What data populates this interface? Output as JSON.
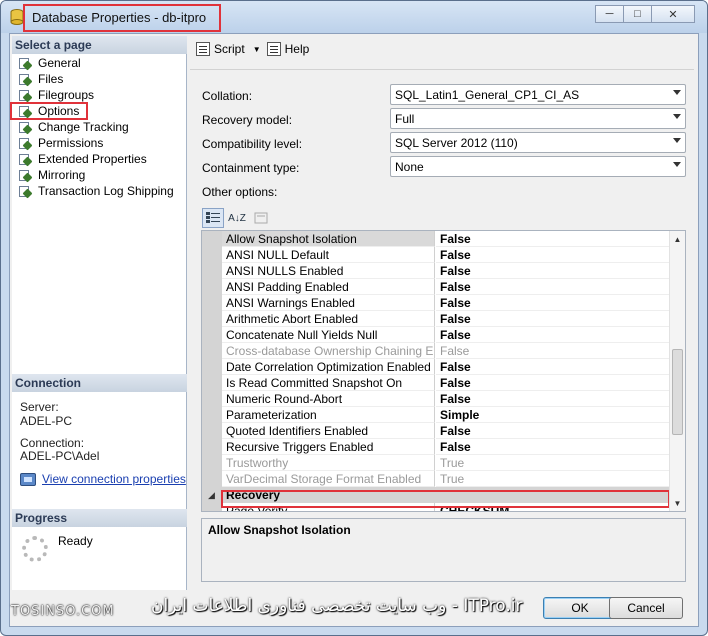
{
  "window": {
    "title": "Database Properties - db-itpro",
    "min_glyph": "─",
    "max_glyph": "□",
    "close_glyph": "✕"
  },
  "left": {
    "select_page_header": "Select a page",
    "pages": [
      {
        "label": "General"
      },
      {
        "label": "Files"
      },
      {
        "label": "Filegroups"
      },
      {
        "label": "Options"
      },
      {
        "label": "Change Tracking"
      },
      {
        "label": "Permissions"
      },
      {
        "label": "Extended Properties"
      },
      {
        "label": "Mirroring"
      },
      {
        "label": "Transaction Log Shipping"
      }
    ],
    "connection_header": "Connection",
    "server_label": "Server:",
    "server_value": "ADEL-PC",
    "connection_label": "Connection:",
    "connection_value": "ADEL-PC\\Adel",
    "view_connection_link": "View connection properties",
    "progress_header": "Progress",
    "progress_status": "Ready"
  },
  "toolbar": {
    "script_label": "Script",
    "help_label": "Help"
  },
  "form": {
    "collation_label": "Collation:",
    "collation_value": "SQL_Latin1_General_CP1_CI_AS",
    "recovery_label": "Recovery model:",
    "recovery_value": "Full",
    "compat_label": "Compatibility level:",
    "compat_value": "SQL Server 2012 (110)",
    "containment_label": "Containment type:",
    "containment_value": "None",
    "other_options_label": "Other options:"
  },
  "grid_toolbar": {
    "categorized_icon": "categorized-icon",
    "alpha_glyph": "A↓Z",
    "pages_icon": "property-pages-icon"
  },
  "property_grid": {
    "rows": [
      {
        "name": "Allow Snapshot Isolation",
        "value": "False"
      },
      {
        "name": "ANSI NULL Default",
        "value": "False"
      },
      {
        "name": "ANSI NULLS Enabled",
        "value": "False"
      },
      {
        "name": "ANSI Padding Enabled",
        "value": "False"
      },
      {
        "name": "ANSI Warnings Enabled",
        "value": "False"
      },
      {
        "name": "Arithmetic Abort Enabled",
        "value": "False"
      },
      {
        "name": "Concatenate Null Yields Null",
        "value": "False"
      },
      {
        "name": "Cross-database Ownership Chaining Enabled",
        "value": "False"
      },
      {
        "name": "Date Correlation Optimization Enabled",
        "value": "False"
      },
      {
        "name": "Is Read Committed Snapshot On",
        "value": "False"
      },
      {
        "name": "Numeric Round-Abort",
        "value": "False"
      },
      {
        "name": "Parameterization",
        "value": "Simple"
      },
      {
        "name": "Quoted Identifiers Enabled",
        "value": "False"
      },
      {
        "name": "Recursive Triggers Enabled",
        "value": "False"
      },
      {
        "name": "Trustworthy",
        "value": "True"
      },
      {
        "name": "VarDecimal Storage Format Enabled",
        "value": "True"
      }
    ],
    "category": {
      "name": "Recovery",
      "toggle": "◢"
    },
    "after_category": [
      {
        "name": "Page Verify",
        "value": "CHECKSUM"
      }
    ],
    "description_title": "Allow Snapshot Isolation"
  },
  "buttons": {
    "ok": "OK",
    "cancel": "Cancel"
  },
  "watermark": {
    "left": "TOSINSO.COM",
    "right": "ITPro.ir - وب سایت تخصصی فناوری اطلاعات ایران"
  },
  "colors": {
    "highlight_red": "#e0323a",
    "link_blue": "#1a3fb0"
  }
}
